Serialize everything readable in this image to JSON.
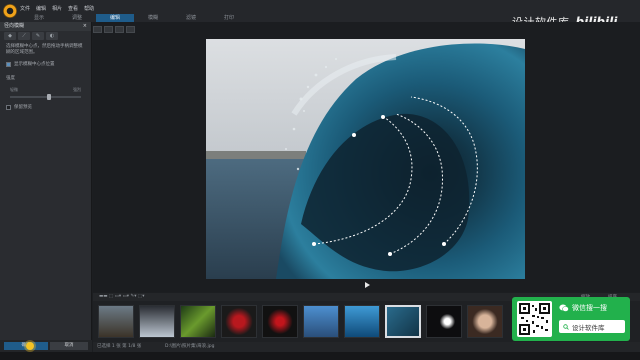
{
  "menu": [
    "文件",
    "编辑",
    "相片",
    "查看",
    "帮助"
  ],
  "mode_tabs": [
    {
      "label": "显示",
      "active": false
    },
    {
      "label": "调整",
      "active": false
    },
    {
      "label": "编辑",
      "active": true
    },
    {
      "label": "模糊",
      "active": false
    },
    {
      "label": "滤镜",
      "active": false
    },
    {
      "label": "打印",
      "active": false
    }
  ],
  "brand": {
    "text": "设计软件库",
    "logo": "bilibili"
  },
  "left_panel": {
    "title": "径向模糊",
    "close": "×",
    "tools": [
      "◆",
      "⟋",
      "✎",
      "◐"
    ],
    "description": "选择模糊中心点，然后拖动手柄调整模糊的区域范围。",
    "checkbox_show_center": "显示模糊中心点位置",
    "amount_label": "强度",
    "slider_min": "轻微",
    "slider_max": "强烈",
    "amount_value": 0.55,
    "checkbox_preview": "保留预览",
    "ok_label": "确定",
    "cancel_label": "取消"
  },
  "filmstrip_bar": {
    "left": "▬▬  ⬚  ▭▾  ▭▾  ✎▾  ⬚▾",
    "right_a": "缩放",
    "right_b": "排序"
  },
  "status": {
    "count": "已选择 1 张    第 1/8 张",
    "path": "D:\\图片\\照片集\\海浪.jpg"
  },
  "wechat": {
    "title": "微信搜一搜",
    "search_text": "设计软件库"
  },
  "colors": {
    "accent": "#1f5c8a",
    "wechat_green": "#22b14c"
  }
}
